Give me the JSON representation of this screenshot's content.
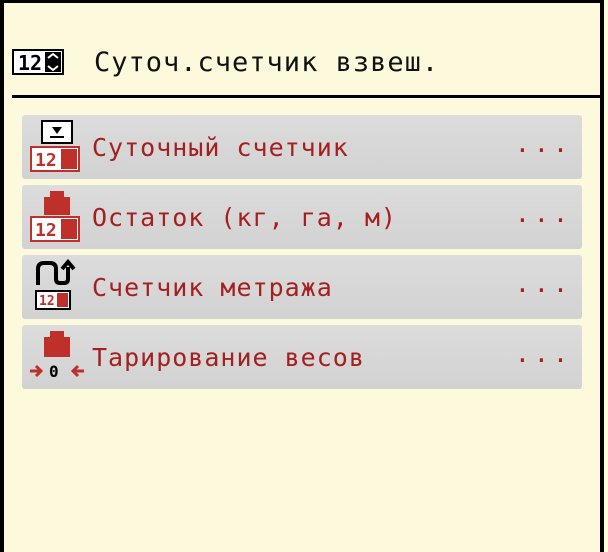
{
  "header": {
    "title": "Суточ.счетчик взвеш.",
    "icon": "counter-digits-icon",
    "icon_digits": "12"
  },
  "menu": {
    "items": [
      {
        "label": "Суточный счетчик",
        "more": "...",
        "icon": "daily-counter-icon",
        "icon_text": "12"
      },
      {
        "label": "Остаток (кг, га, м)",
        "more": "...",
        "icon": "remainder-weight-icon",
        "icon_text": "12"
      },
      {
        "label": "Счетчик метража",
        "more": "...",
        "icon": "distance-counter-icon",
        "icon_text": "12"
      },
      {
        "label": "Тарирование весов",
        "more": "...",
        "icon": "tare-scale-icon",
        "icon_text": "0"
      }
    ]
  },
  "colors": {
    "background": "#fdf9dc",
    "item_background": "#d6d6d6",
    "item_text": "#a3201f",
    "icon_red": "#c0302a",
    "border": "#000000"
  }
}
